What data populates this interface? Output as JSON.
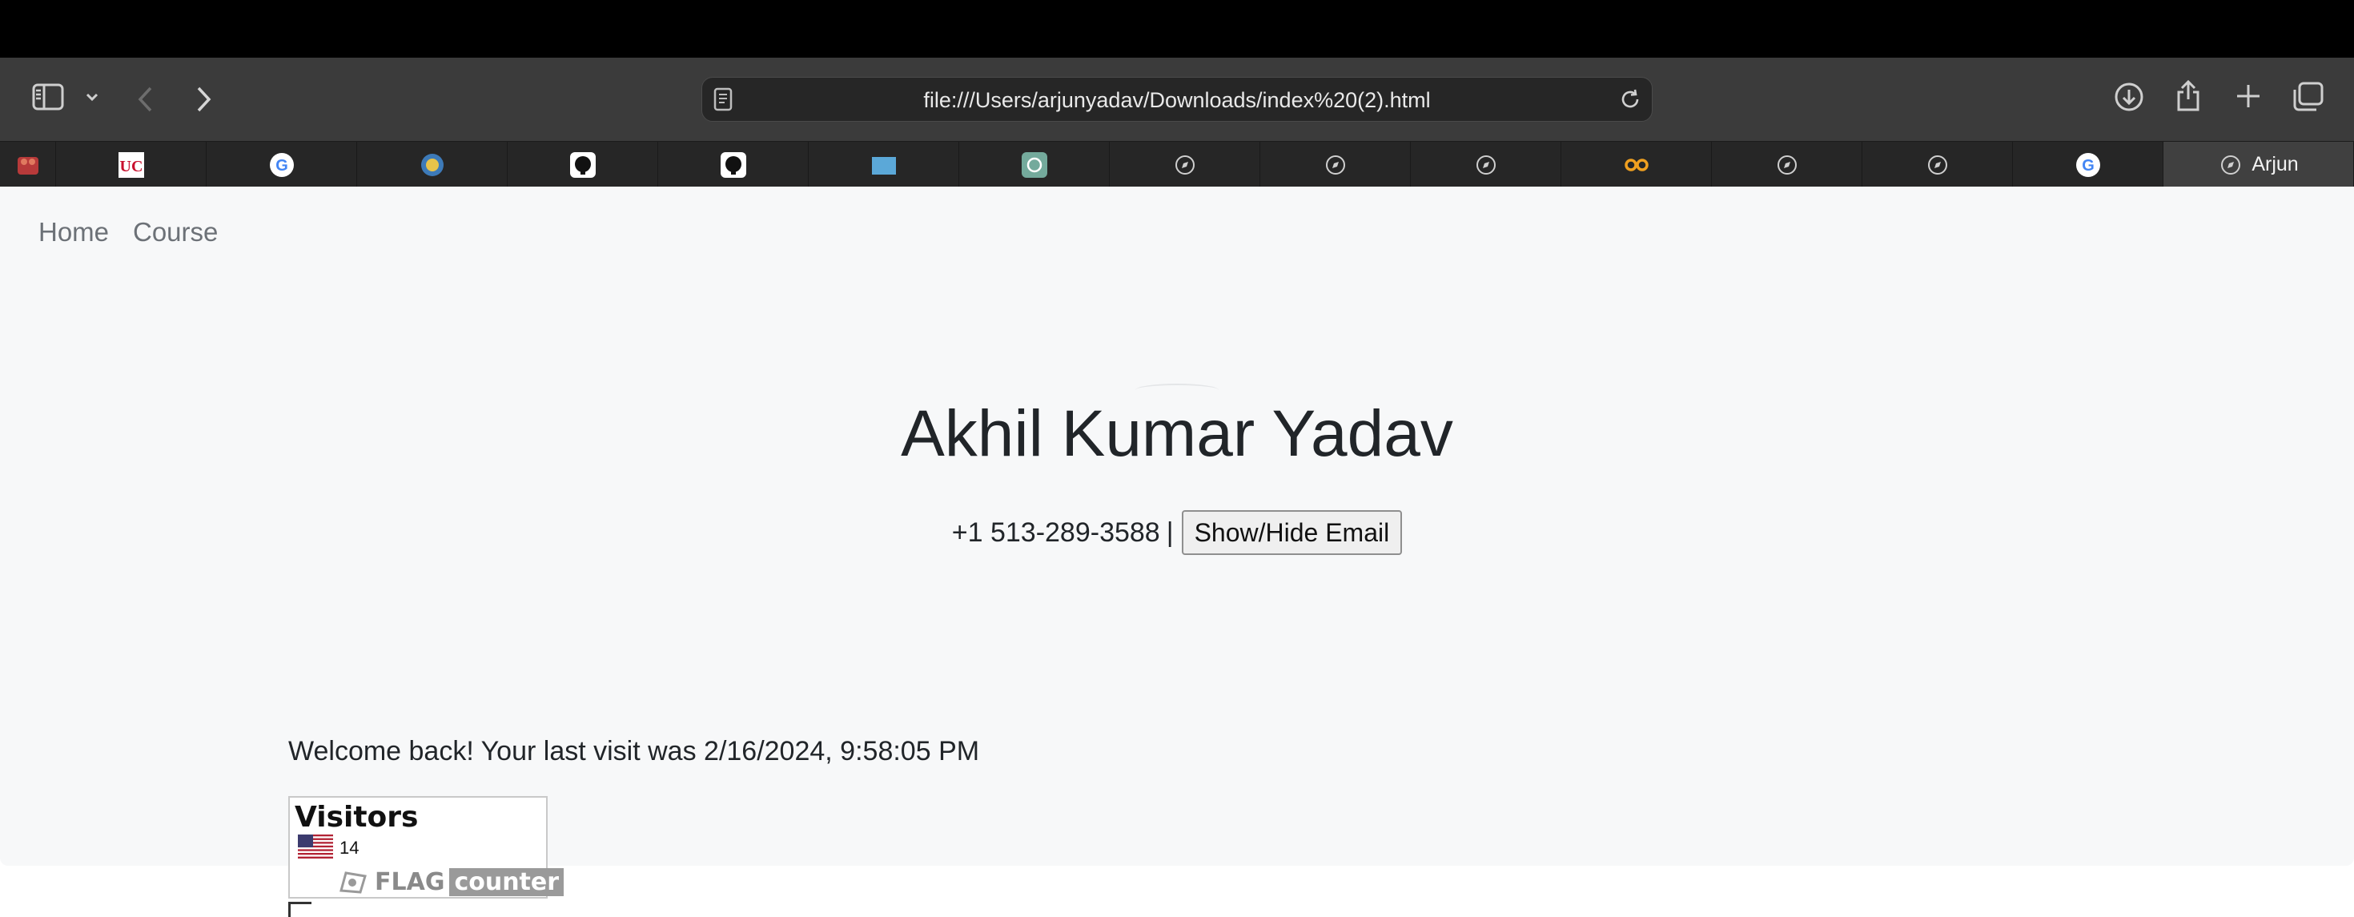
{
  "browser": {
    "url": "file:///Users/arjunyadav/Downloads/index%20(2).html",
    "active_tab_label": "Arjun",
    "tabs": [
      {
        "icon": "app-icon"
      },
      {
        "icon": "uc-logo-icon"
      },
      {
        "icon": "google-icon"
      },
      {
        "icon": "globe-seal-icon"
      },
      {
        "icon": "github-icon"
      },
      {
        "icon": "github-icon"
      },
      {
        "icon": "blue-square-icon"
      },
      {
        "icon": "chatgpt-icon"
      },
      {
        "icon": "compass-icon"
      },
      {
        "icon": "compass-icon"
      },
      {
        "icon": "compass-icon"
      },
      {
        "icon": "infinity-icon"
      },
      {
        "icon": "compass-icon"
      },
      {
        "icon": "compass-icon"
      },
      {
        "icon": "google-icon"
      },
      {
        "icon": "compass-icon"
      }
    ]
  },
  "nav": {
    "home": "Home",
    "course": "Course"
  },
  "hero": {
    "name": "Akhil Kumar Yadav",
    "phone": "+1 513-289-3588",
    "separator": "|",
    "email_button": "Show/Hide Email"
  },
  "welcome": "Welcome back! Your last visit was 2/16/2024, 9:58:05 PM",
  "flag_counter": {
    "title": "Visitors",
    "country_flag": "us-flag-icon",
    "count": "14",
    "logo_left": "FLAG",
    "logo_right": "counter"
  },
  "colors": {
    "toolbar": "#3b3b3b",
    "hero_bg": "#f7f8f9",
    "text": "#212529",
    "nav_link": "#6c7177"
  }
}
